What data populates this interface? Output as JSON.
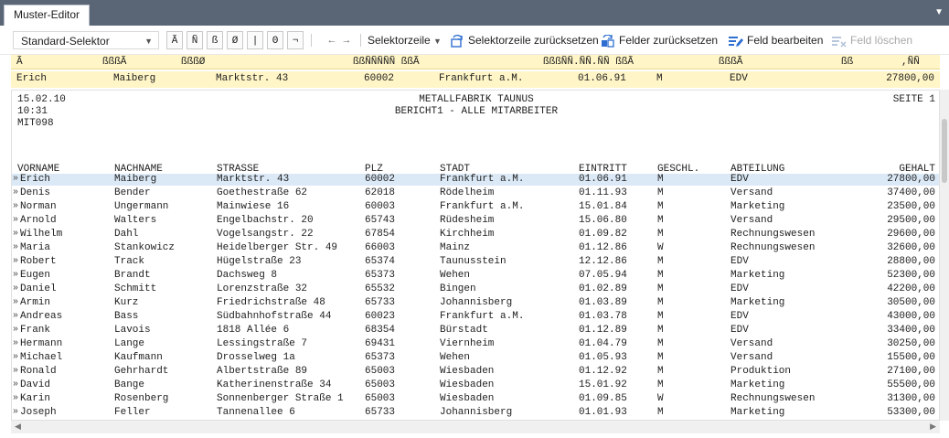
{
  "tab": {
    "title": "Muster-Editor"
  },
  "toolbar": {
    "selector_value": "Standard-Selektor",
    "char_buttons": [
      "Ã",
      "Ñ",
      "ß",
      "Ø",
      "|",
      "Θ",
      "¬"
    ],
    "nav_prev": "←",
    "nav_next": "→",
    "selector_row_label": "Selektorzeile",
    "reset_selector_row_label": "Selektorzeile zurücksetzen",
    "reset_fields_label": "Felder zurücksetzen",
    "edit_field_label": "Feld bearbeiten",
    "delete_field_label": "Feld löschen"
  },
  "selector_header": {
    "cells": [
      "Ã",
      "ßßßÃ",
      "ßßßØ",
      "ßßÑÑÑÑÑ ßßÃ",
      "ßßßÑÑ.ÑÑ.ÑÑ ßßÃ",
      "ßßßÃ",
      "ßß",
      ",ÑÑ"
    ]
  },
  "selector_row": {
    "cells": [
      "Erich",
      "Maiberg",
      "Marktstr. 43",
      "60002",
      "Frankfurt a.M.",
      "01.06.91",
      "M",
      "EDV",
      "27800,00"
    ]
  },
  "report": {
    "date": "15.02.10",
    "time": "10:31",
    "code": "MIT098",
    "company": "METALLFABRIK TAUNUS",
    "subtitle": "BERICHT1 - ALLE MITARBEITER",
    "page": "SEITE 1",
    "columns": [
      "VORNAME",
      "NACHNAME",
      "STRASSE",
      "PLZ",
      "STADT",
      "EINTRITT",
      "GESCHL.",
      "ABTEILUNG",
      "GEHALT"
    ],
    "marker": "»",
    "rows": [
      [
        "Erich",
        "Maiberg",
        "Marktstr. 43",
        "60002",
        "Frankfurt a.M.",
        "01.06.91",
        "M",
        "EDV",
        "27800,00"
      ],
      [
        "Denis",
        "Bender",
        "Goethestraße 62",
        "62018",
        "Rödelheim",
        "01.11.93",
        "M",
        "Versand",
        "37400,00"
      ],
      [
        "Norman",
        "Ungermann",
        "Mainwiese 16",
        "60003",
        "Frankfurt a.M.",
        "15.01.84",
        "M",
        "Marketing",
        "23500,00"
      ],
      [
        "Arnold",
        "Walters",
        "Engelbachstr. 20",
        "65743",
        "Rüdesheim",
        "15.06.80",
        "M",
        "Versand",
        "29500,00"
      ],
      [
        "Wilhelm",
        "Dahl",
        "Vogelsangstr. 22",
        "67854",
        "Kirchheim",
        "01.09.82",
        "M",
        "Rechnungswesen",
        "29600,00"
      ],
      [
        "Maria",
        "Stankowicz",
        "Heidelberger Str. 49",
        "66003",
        "Mainz",
        "01.12.86",
        "W",
        "Rechnungswesen",
        "32600,00"
      ],
      [
        "Robert",
        "Track",
        "Hügelstraße 23",
        "65374",
        "Taunusstein",
        "12.12.86",
        "M",
        "EDV",
        "28800,00"
      ],
      [
        "Eugen",
        "Brandt",
        "Dachsweg 8",
        "65373",
        "Wehen",
        "07.05.94",
        "M",
        "Marketing",
        "52300,00"
      ],
      [
        "Daniel",
        "Schmitt",
        "Lorenzstraße 32",
        "65532",
        "Bingen",
        "01.02.89",
        "M",
        "EDV",
        "42200,00"
      ],
      [
        "Armin",
        "Kurz",
        "Friedrichstraße 48",
        "65733",
        "Johannisberg",
        "01.03.89",
        "M",
        "Marketing",
        "30500,00"
      ],
      [
        "Andreas",
        "Bass",
        "Südbahnhofstraße 44",
        "60023",
        "Frankfurt a.M.",
        "01.03.78",
        "M",
        "EDV",
        "43000,00"
      ],
      [
        "Frank",
        "Lavois",
        "1818 Allée 6",
        "68354",
        "Bürstadt",
        "01.12.89",
        "M",
        "EDV",
        "33400,00"
      ],
      [
        "Hermann",
        "Lange",
        "Lessingstraße 7",
        "69431",
        "Viernheim",
        "01.04.79",
        "M",
        "Versand",
        "30250,00"
      ],
      [
        "Michael",
        "Kaufmann",
        "Drosselweg 1a",
        "65373",
        "Wehen",
        "01.05.93",
        "M",
        "Versand",
        "15500,00"
      ],
      [
        "Ronald",
        "Gehrhardt",
        "Albertstraße 89",
        "65003",
        "Wiesbaden",
        "01.12.92",
        "M",
        "Produktion",
        "27100,00"
      ],
      [
        "David",
        "Bange",
        "Katherinenstraße 34",
        "65003",
        "Wiesbaden",
        "15.01.92",
        "M",
        "Marketing",
        "55500,00"
      ],
      [
        "Karin",
        "Rosenberg",
        "Sonnenberger Straße 1",
        "65003",
        "Wiesbaden",
        "01.09.85",
        "W",
        "Rechnungswesen",
        "31300,00"
      ],
      [
        "Joseph",
        "Feller",
        "Tannenallee 6",
        "65733",
        "Johannisberg",
        "01.01.93",
        "M",
        "Marketing",
        "53300,00"
      ]
    ]
  },
  "colors": {
    "header_bar": "#5a6576",
    "selector_yellow": "#fff5c6",
    "row_highlight": "#dbe9f7",
    "icon_blue": "#2f6fd1"
  }
}
